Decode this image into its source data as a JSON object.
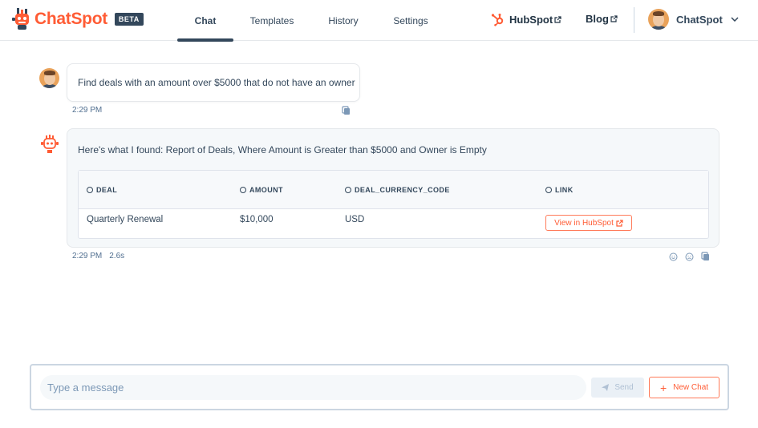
{
  "brand": {
    "name": "ChatSpot",
    "badge": "BETA",
    "accent_color": "#ff5c35",
    "logo_icon": "chatspot-robot-logo-icon"
  },
  "nav": {
    "tabs": [
      {
        "label": "Chat",
        "active": true
      },
      {
        "label": "Templates",
        "active": false
      },
      {
        "label": "History",
        "active": false
      },
      {
        "label": "Settings",
        "active": false
      }
    ]
  },
  "header_links": {
    "hubspot": {
      "label": "HubSpot",
      "icon": "hubspot-sprocket-icon",
      "trailing_icon": "external-link-icon"
    },
    "blog": {
      "label": "Blog",
      "trailing_icon": "external-link-icon"
    }
  },
  "account": {
    "name": "ChatSpot",
    "avatar_icon": "user-avatar",
    "menu_icon": "chevron-down-icon"
  },
  "conversation": {
    "user_message": {
      "text": "Find deals with an amount over $5000 that do not have an owner",
      "time": "2:29 PM",
      "copy_icon": "copy-icon"
    },
    "bot_message": {
      "text": "Here's what I found: Report of Deals, Where Amount is Greater than $5000 and Owner is Empty",
      "time": "2:29 PM",
      "duration": "2.6s",
      "table": {
        "columns": [
          "DEAL",
          "AMOUNT",
          "DEAL_CURRENCY_CODE",
          "LINK"
        ],
        "rows": [
          {
            "deal": "Quarterly Renewal",
            "amount": "$10,000",
            "currency": "USD",
            "link_label": "View in HubSpot"
          }
        ]
      },
      "feedback_icons": [
        "smile-icon",
        "frown-icon",
        "copy-icon"
      ]
    }
  },
  "composer": {
    "placeholder": "Type a message",
    "value": "",
    "send_label": "Send",
    "send_icon": "paper-plane-icon",
    "new_chat_label": "New Chat",
    "new_chat_icon": "plus-icon"
  }
}
